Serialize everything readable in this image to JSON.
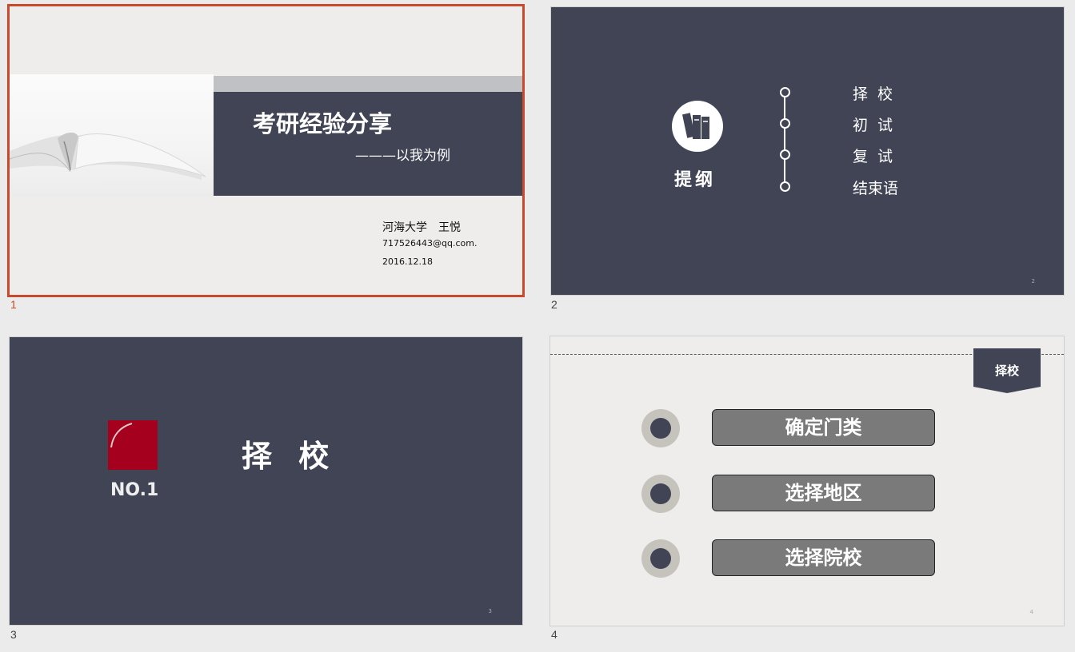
{
  "slides": [
    {
      "number": "1",
      "title": "考研经验分享",
      "subtitle": "———以我为例",
      "author": "河海大学　王悦",
      "email": "717526443@qq.com.",
      "date": "2016.12.18"
    },
    {
      "number": "2",
      "heading": "提纲",
      "items": [
        "择 校",
        "初 试",
        "复 试",
        "结束语"
      ],
      "page_number": "2"
    },
    {
      "number": "3",
      "label": "NO.1",
      "title": "择 校",
      "page_number": "3"
    },
    {
      "number": "4",
      "tag": "择校",
      "items": [
        "确定门类",
        "选择地区",
        "选择院校"
      ],
      "page_number": "4"
    }
  ],
  "colors": {
    "selection": "#c8492b",
    "dark_slide": "#414455",
    "accent_red": "#a5011e",
    "button_gray": "#7a7a7a"
  }
}
